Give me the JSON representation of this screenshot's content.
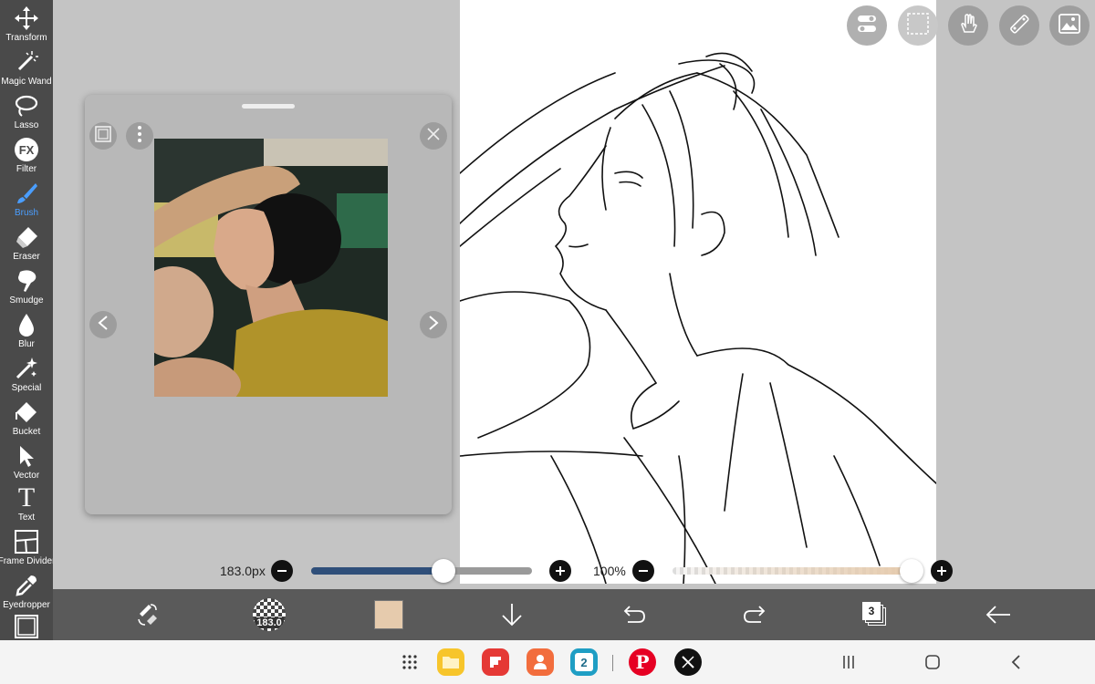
{
  "toolbar": {
    "tools": [
      {
        "label": "Transform",
        "icon": "move-arrows-icon"
      },
      {
        "label": "Magic Wand",
        "icon": "magic-wand-icon"
      },
      {
        "label": "Lasso",
        "icon": "lasso-icon"
      },
      {
        "label": "Filter",
        "icon": "fx-icon",
        "glyph": "FX"
      },
      {
        "label": "Brush",
        "icon": "brush-icon",
        "active": true
      },
      {
        "label": "Eraser",
        "icon": "eraser-icon"
      },
      {
        "label": "Smudge",
        "icon": "smudge-icon"
      },
      {
        "label": "Blur",
        "icon": "drop-icon"
      },
      {
        "label": "Special",
        "icon": "sparkle-icon"
      },
      {
        "label": "Bucket",
        "icon": "bucket-icon"
      },
      {
        "label": "Vector",
        "icon": "vector-arrow-icon"
      },
      {
        "label": "Text",
        "icon": "text-icon",
        "glyph": "T"
      },
      {
        "label": "Frame Divider",
        "icon": "frame-divider-icon"
      },
      {
        "label": "Eyedropper",
        "icon": "eyedropper-icon"
      },
      {
        "label": "",
        "icon": "canvas-frame-icon"
      }
    ]
  },
  "reference_window": {
    "photo_desc_icon": "reference-photo"
  },
  "brush_size": {
    "label": "183.0px",
    "value_fraction": 0.6
  },
  "opacity": {
    "label": "100%",
    "value_fraction": 1.0
  },
  "action_bar": {
    "brush_preview_text": "183.0",
    "current_color": "#e6cbad",
    "layer_count": "3"
  },
  "colors": {
    "accent": "#4a9eff",
    "brush_track": "#2f4f7a",
    "toolbar": "#4a4a4a"
  },
  "sysbar": {
    "apps": [
      "app-drawer-icon",
      "files-app-icon",
      "flipboard-app-icon",
      "contacts-app-icon",
      "calendar-app-icon",
      "pinterest-app-icon",
      "x-app-icon"
    ],
    "calendar_day": "2"
  }
}
